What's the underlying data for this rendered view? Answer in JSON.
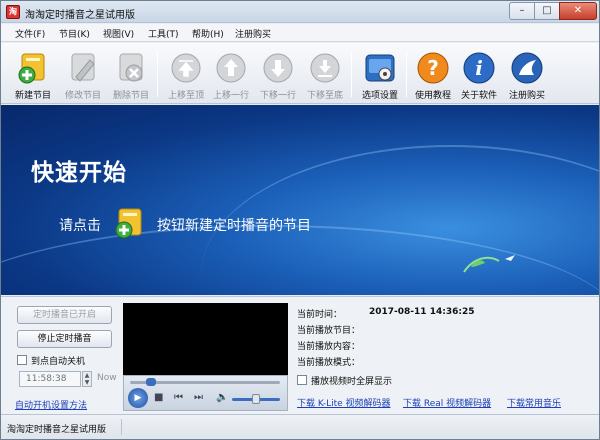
{
  "window": {
    "title": "淘淘定时播音之星试用版",
    "app_icon_text": "淘"
  },
  "menu": [
    "文件(F)",
    "节目(K)",
    "视图(V)",
    "工具(T)",
    "帮助(H)",
    "注册购买"
  ],
  "toolbar": [
    {
      "label": "新建节目",
      "icon": "add-program-icon",
      "enabled": true
    },
    {
      "label": "修改节目",
      "icon": "edit-program-icon",
      "enabled": false
    },
    {
      "label": "删除节目",
      "icon": "delete-program-icon",
      "enabled": false
    },
    {
      "label": "上移至顶",
      "icon": "move-top-icon",
      "enabled": false
    },
    {
      "label": "上移一行",
      "icon": "move-up-icon",
      "enabled": false
    },
    {
      "label": "下移一行",
      "icon": "move-down-icon",
      "enabled": false
    },
    {
      "label": "下移至底",
      "icon": "move-bottom-icon",
      "enabled": false
    },
    {
      "label": "选项设置",
      "icon": "settings-icon",
      "enabled": true
    },
    {
      "label": "使用教程",
      "icon": "help-icon",
      "enabled": true
    },
    {
      "label": "关于软件",
      "icon": "about-icon",
      "enabled": true
    },
    {
      "label": "注册购买",
      "icon": "register-icon",
      "enabled": true
    }
  ],
  "banner": {
    "title": "快速开始",
    "hint_prefix": "请点击",
    "hint_suffix": "按钮新建定时播音的节目"
  },
  "controls": {
    "timer_status_button": "定时播音已开启",
    "stop_timer_button": "停止定时播音",
    "auto_shutdown_label": "到点自动关机",
    "shutdown_time": "11:58:38",
    "now_button": "Now",
    "boot_link": "自动开机设置方法"
  },
  "player": {
    "fullscreen_label": "播放视频时全屏显示"
  },
  "info": {
    "current_time_label": "当前时间：",
    "current_time_value": "2017-08-11 14:36:25",
    "playing_program_label": "当前播放节目：",
    "playing_content_label": "当前播放内容：",
    "playing_mode_label": "当前播放模式："
  },
  "links": {
    "klite": "下载 K-Lite 视频解码器",
    "real": "下载 Real 视频解码器",
    "music": "下载常用音乐"
  },
  "status": {
    "text": "淘淘定时播音之星试用版"
  },
  "colors": {
    "accent_blue": "#1b5fb8",
    "link": "#1c3fb8",
    "close_button": "#c6402b"
  }
}
